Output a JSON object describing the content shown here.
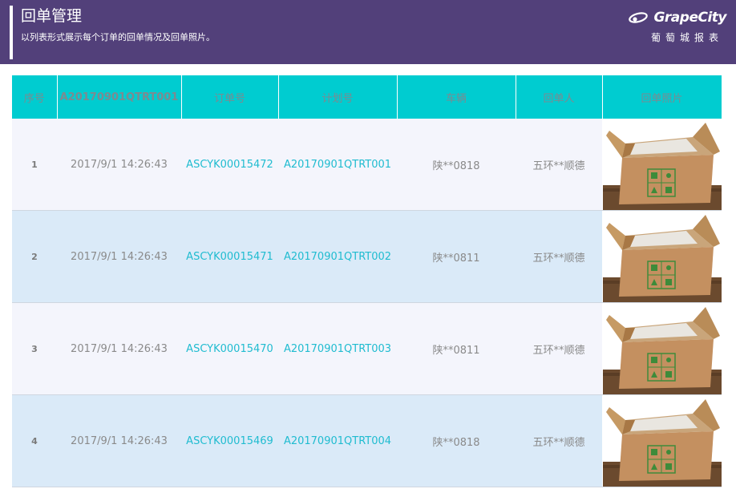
{
  "header": {
    "title": "回单管理",
    "subtitle": "以列表形式展示每个订单的回单情况及回单照片。",
    "brand_name": "GrapeCity",
    "brand_cn": "葡萄城报表"
  },
  "table": {
    "columns": [
      "序号",
      "A20170901QTRT001",
      "订单号",
      "计划号",
      "车辆",
      "回单人",
      "回单照片"
    ],
    "rows": [
      {
        "seq": "1",
        "time": "2017/9/1 14:26:43",
        "order": "ASCYK00015472",
        "plan": "A20170901QTRT001",
        "vehicle": "陕**0818",
        "receiver": "五环**顺德"
      },
      {
        "seq": "2",
        "time": "2017/9/1 14:26:43",
        "order": "ASCYK00015471",
        "plan": "A20170901QTRT002",
        "vehicle": "陕**0811",
        "receiver": "五环**顺德"
      },
      {
        "seq": "3",
        "time": "2017/9/1 14:26:43",
        "order": "ASCYK00015470",
        "plan": "A20170901QTRT003",
        "vehicle": "陕**0811",
        "receiver": "五环**顺德"
      },
      {
        "seq": "4",
        "time": "2017/9/1 14:26:43",
        "order": "ASCYK00015469",
        "plan": "A20170901QTRT004",
        "vehicle": "陕**0818",
        "receiver": "五环**顺德"
      }
    ]
  },
  "colors": {
    "header_bg": "#52407a",
    "table_header_bg": "#00ccd0",
    "row_odd_bg": "#f4f5fc",
    "row_even_bg": "#daeaf8",
    "link_color": "#20bcd0"
  },
  "icons": {
    "brand": "grapecity-logo-icon",
    "photo": "cardboard-box-photo"
  }
}
